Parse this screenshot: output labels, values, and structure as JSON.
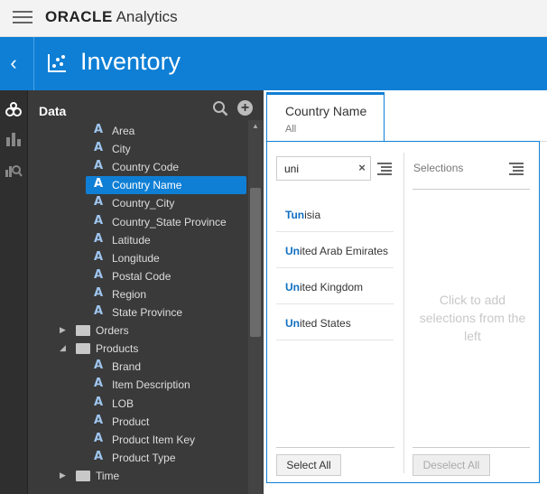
{
  "app": {
    "brand_strong": "ORACLE",
    "brand_rest": " Analytics"
  },
  "header": {
    "title": "Inventory"
  },
  "data_panel": {
    "title": "Data",
    "items": [
      {
        "label": "Area",
        "kind": "attribute",
        "level": 2
      },
      {
        "label": "City",
        "kind": "attribute",
        "level": 2
      },
      {
        "label": "Country Code",
        "kind": "attribute",
        "level": 2
      },
      {
        "label": "Country Name",
        "kind": "attribute",
        "level": 2,
        "selected": true
      },
      {
        "label": "Country_City",
        "kind": "attribute",
        "level": 2
      },
      {
        "label": "Country_State Province",
        "kind": "attribute",
        "level": 2
      },
      {
        "label": "Latitude",
        "kind": "attribute",
        "level": 2
      },
      {
        "label": "Longitude",
        "kind": "attribute",
        "level": 2
      },
      {
        "label": "Postal Code",
        "kind": "attribute",
        "level": 2
      },
      {
        "label": "Region",
        "kind": "attribute",
        "level": 2
      },
      {
        "label": "State Province",
        "kind": "attribute",
        "level": 2
      },
      {
        "label": "Orders",
        "kind": "folder",
        "level": 1,
        "expanded": false
      },
      {
        "label": "Products",
        "kind": "folder",
        "level": 1,
        "expanded": true
      },
      {
        "label": "Brand",
        "kind": "attribute",
        "level": 2
      },
      {
        "label": "Item Description",
        "kind": "attribute",
        "level": 2
      },
      {
        "label": "LOB",
        "kind": "attribute",
        "level": 2
      },
      {
        "label": "Product",
        "kind": "attribute",
        "level": 2
      },
      {
        "label": "Product Item Key",
        "kind": "attribute",
        "level": 2
      },
      {
        "label": "Product Type",
        "kind": "attribute",
        "level": 2
      },
      {
        "label": "Time",
        "kind": "folder",
        "level": 1,
        "expanded": false
      }
    ]
  },
  "filter": {
    "name": "Country Name",
    "value": "All",
    "search_value": "uni",
    "clear_glyph": "×",
    "options": [
      {
        "match": "Tun",
        "rest": "isia"
      },
      {
        "match": "Un",
        "rest": "ited Arab Emirates"
      },
      {
        "match": "Un",
        "rest": "ited Kingdom"
      },
      {
        "match": "Un",
        "rest": "ited States"
      }
    ],
    "selections_title": "Selections",
    "empty_hint": "Click to add selections from the left",
    "select_all_label": "Select All",
    "deselect_all_label": "Deselect All"
  },
  "colors": {
    "accent": "#0f7fd5",
    "panel_bg": "#3a3a3a",
    "rail_bg": "#2f2f2f",
    "match_text": "#0f6fc0"
  }
}
